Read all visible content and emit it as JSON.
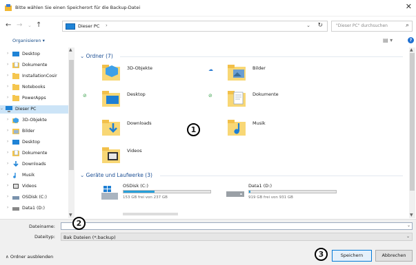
{
  "window": {
    "title": "Bitte wählen Sie einen Speicherort für die Backup-Datei",
    "close": "✕"
  },
  "nav": {
    "back": "←",
    "forward": "→",
    "recent": "⌄",
    "up": "↑",
    "address_crumb": "Dieser PC",
    "address_arrow": "›",
    "address_dropdown": "⌄",
    "refresh": "↻",
    "search_placeholder": "\"Dieser PC\" durchsuchen",
    "search_icon": "⌕"
  },
  "toolbar": {
    "organize": "Organisieren ▾",
    "view": "▤ ▾",
    "help": "?"
  },
  "sidebar": {
    "items": [
      {
        "label": "Desktop",
        "icon": "desktop-icon",
        "color": "#1f83d6"
      },
      {
        "label": "Dokumente",
        "icon": "documents-icon",
        "color": "#8aa9c4"
      },
      {
        "label": "InstallationCosir",
        "icon": "folder-icon",
        "color": "#f5c64f"
      },
      {
        "label": "Notebooks",
        "icon": "folder-icon",
        "color": "#f5c64f"
      },
      {
        "label": "PowerApps",
        "icon": "folder-icon",
        "color": "#f5c64f"
      },
      {
        "label": "Dieser PC",
        "icon": "pc-icon",
        "color": "#1f83d6"
      },
      {
        "label": "3D-Objekte",
        "icon": "3d-objects-icon",
        "color": "#3ea0e8"
      },
      {
        "label": "Bilder",
        "icon": "pictures-icon",
        "color": "#9ab6cf"
      },
      {
        "label": "Desktop",
        "icon": "desktop-icon",
        "color": "#1f83d6"
      },
      {
        "label": "Dokumente",
        "icon": "documents-icon",
        "color": "#8aa9c4"
      },
      {
        "label": "Downloads",
        "icon": "downloads-icon",
        "color": "#1f83d6"
      },
      {
        "label": "Musik",
        "icon": "music-icon",
        "color": "#2e8fde"
      },
      {
        "label": "Videos",
        "icon": "videos-icon",
        "color": "#444"
      },
      {
        "label": "OSDisk (C:)",
        "icon": "drive-icon",
        "color": "#7a93ad"
      },
      {
        "label": "Data1 (D:)",
        "icon": "drive-icon",
        "color": "#888"
      }
    ]
  },
  "content": {
    "folders_header": "Ordner (7)",
    "folders": [
      {
        "label": "3D-Objekte",
        "icon": "3d-objects-icon",
        "sync": ""
      },
      {
        "label": "Bilder",
        "icon": "pictures-icon",
        "sync": "☁"
      },
      {
        "label": "Desktop",
        "icon": "desktop-icon",
        "sync": "⊘"
      },
      {
        "label": "Dokumente",
        "icon": "documents-icon",
        "sync": "⊘"
      },
      {
        "label": "Downloads",
        "icon": "downloads-icon",
        "sync": ""
      },
      {
        "label": "Musik",
        "icon": "music-icon",
        "sync": ""
      },
      {
        "label": "Videos",
        "icon": "videos-icon",
        "sync": ""
      }
    ],
    "drives_header": "Geräte und Laufwerke (3)",
    "drives": [
      {
        "name": "OSDisk (C:)",
        "free": "153 GB frei von 237 GB",
        "used_fraction": 0.355,
        "icon": "windows-drive-icon"
      },
      {
        "name": "Data1 (D:)",
        "free": "919 GB frei von 931 GB",
        "used_fraction": 0.013,
        "icon": "drive-icon"
      }
    ]
  },
  "footer": {
    "filename_label": "Dateiname:",
    "filename_value": "",
    "filetype_label": "Dateityp:",
    "filetype_value": "Bak Dateien (*.backup)",
    "hide_folders": "∧ Ordner ausblenden",
    "save": "Speichern",
    "cancel": "Abbrechen"
  },
  "callouts": {
    "one": "1",
    "two": "2",
    "three": "3"
  },
  "colors": {
    "accent": "#0078d7",
    "selection": "#cce4f7",
    "group_header": "#1c4f94",
    "drive_fill": "#26a0da"
  }
}
